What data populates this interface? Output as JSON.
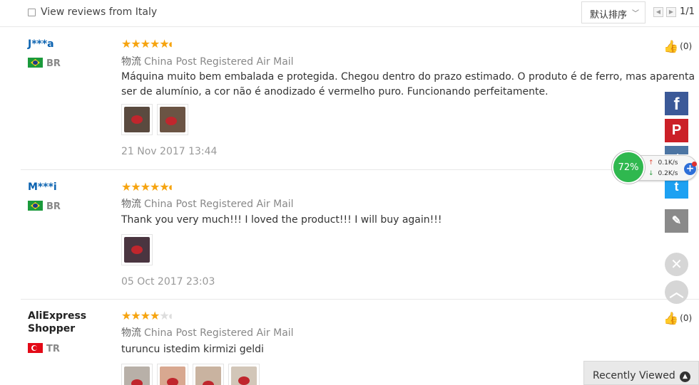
{
  "filter": {
    "checkbox_label": "View reviews from Italy",
    "sort_label": "默认排序",
    "page_count": "1/1"
  },
  "shipping_label": "物流",
  "reviews": [
    {
      "name": "J***a",
      "country": "BR",
      "rating": 5,
      "shipping": "China Post Registered Air Mail",
      "text": "Máquina muito bem embalada e protegida. Chegou dentro do prazo estimado. O produto é de ferro, mas aparenta ser de alumínio, a cor não é anodizado é vermelho puro. Funcionando perfeitamente.",
      "date": "21 Nov 2017 13:44",
      "helpful": "(0)"
    },
    {
      "name": "M***i",
      "country": "BR",
      "rating": 5,
      "shipping": "China Post Registered Air Mail",
      "text": "Thank you very much!!! I loved the product!!! I will buy again!!!",
      "date": "05 Oct 2017 23:03",
      "helpful": "(0)"
    },
    {
      "name": "AliExpress Shopper",
      "country": "TR",
      "rating": 4,
      "shipping": "China Post Registered Air Mail",
      "text": "turuncu istedim kirmizi geldi",
      "helpful": "(0)"
    }
  ],
  "speed_widget": {
    "percent": "72%",
    "upload": "0.1K/s",
    "download": "0.2K/s"
  },
  "social": {
    "facebook_glyph": "f",
    "pinterest_glyph": "P",
    "vk_glyph": "vk",
    "twitter_glyph": "t",
    "edit_glyph": "✎"
  },
  "recently_viewed": "Recently Viewed",
  "icons": [
    "checkbox-icon",
    "chevron-down-icon",
    "prev-page-icon",
    "next-page-icon",
    "star-icon",
    "flag-br-icon",
    "flag-tr-icon",
    "thumbs-up-icon",
    "facebook-icon",
    "pinterest-icon",
    "vk-icon",
    "twitter-icon",
    "edit-icon",
    "close-icon",
    "back-to-top-icon",
    "chevron-up-icon"
  ],
  "colors": {
    "star": "#f6a410",
    "reviewer_link": "#0a62b0",
    "facebook": "#3b5998",
    "pinterest": "#cb2027",
    "twitter": "#1da1f2",
    "speed_gauge": "#2fb84f"
  }
}
